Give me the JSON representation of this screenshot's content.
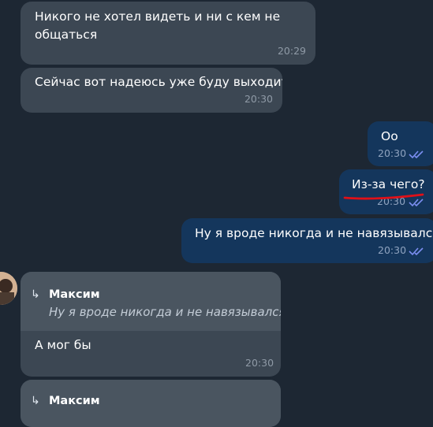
{
  "messages": [
    {
      "text": "Никого не хотел видеть и ни с кем не общаться",
      "time": "20:29"
    },
    {
      "text": "Сейчас вот надеюсь уже буду выходить",
      "time": "20:30"
    },
    {
      "text": "Оо",
      "time": "20:30",
      "status_icon": "double-check-icon"
    },
    {
      "text": "Из-за чего?",
      "time": "20:30",
      "status_icon": "double-check-icon"
    },
    {
      "text": "Ну я вроде никогда и не навязывался)",
      "time": "20:30",
      "status_icon": "double-check-icon"
    },
    {
      "reply_to": {
        "author": "Максим",
        "text": "Ну я вроде никогда и не навязывался)"
      },
      "text": "А мог бы",
      "time": "20:30"
    },
    {
      "reply_to": {
        "author": "Максим"
      }
    }
  ],
  "colors": {
    "background": "#1d2733",
    "incoming_bubble": "#3c4753",
    "outgoing_bubble": "#14365c",
    "read_ticks": "#7b8ef0",
    "annotation_underline": "#e01018"
  }
}
